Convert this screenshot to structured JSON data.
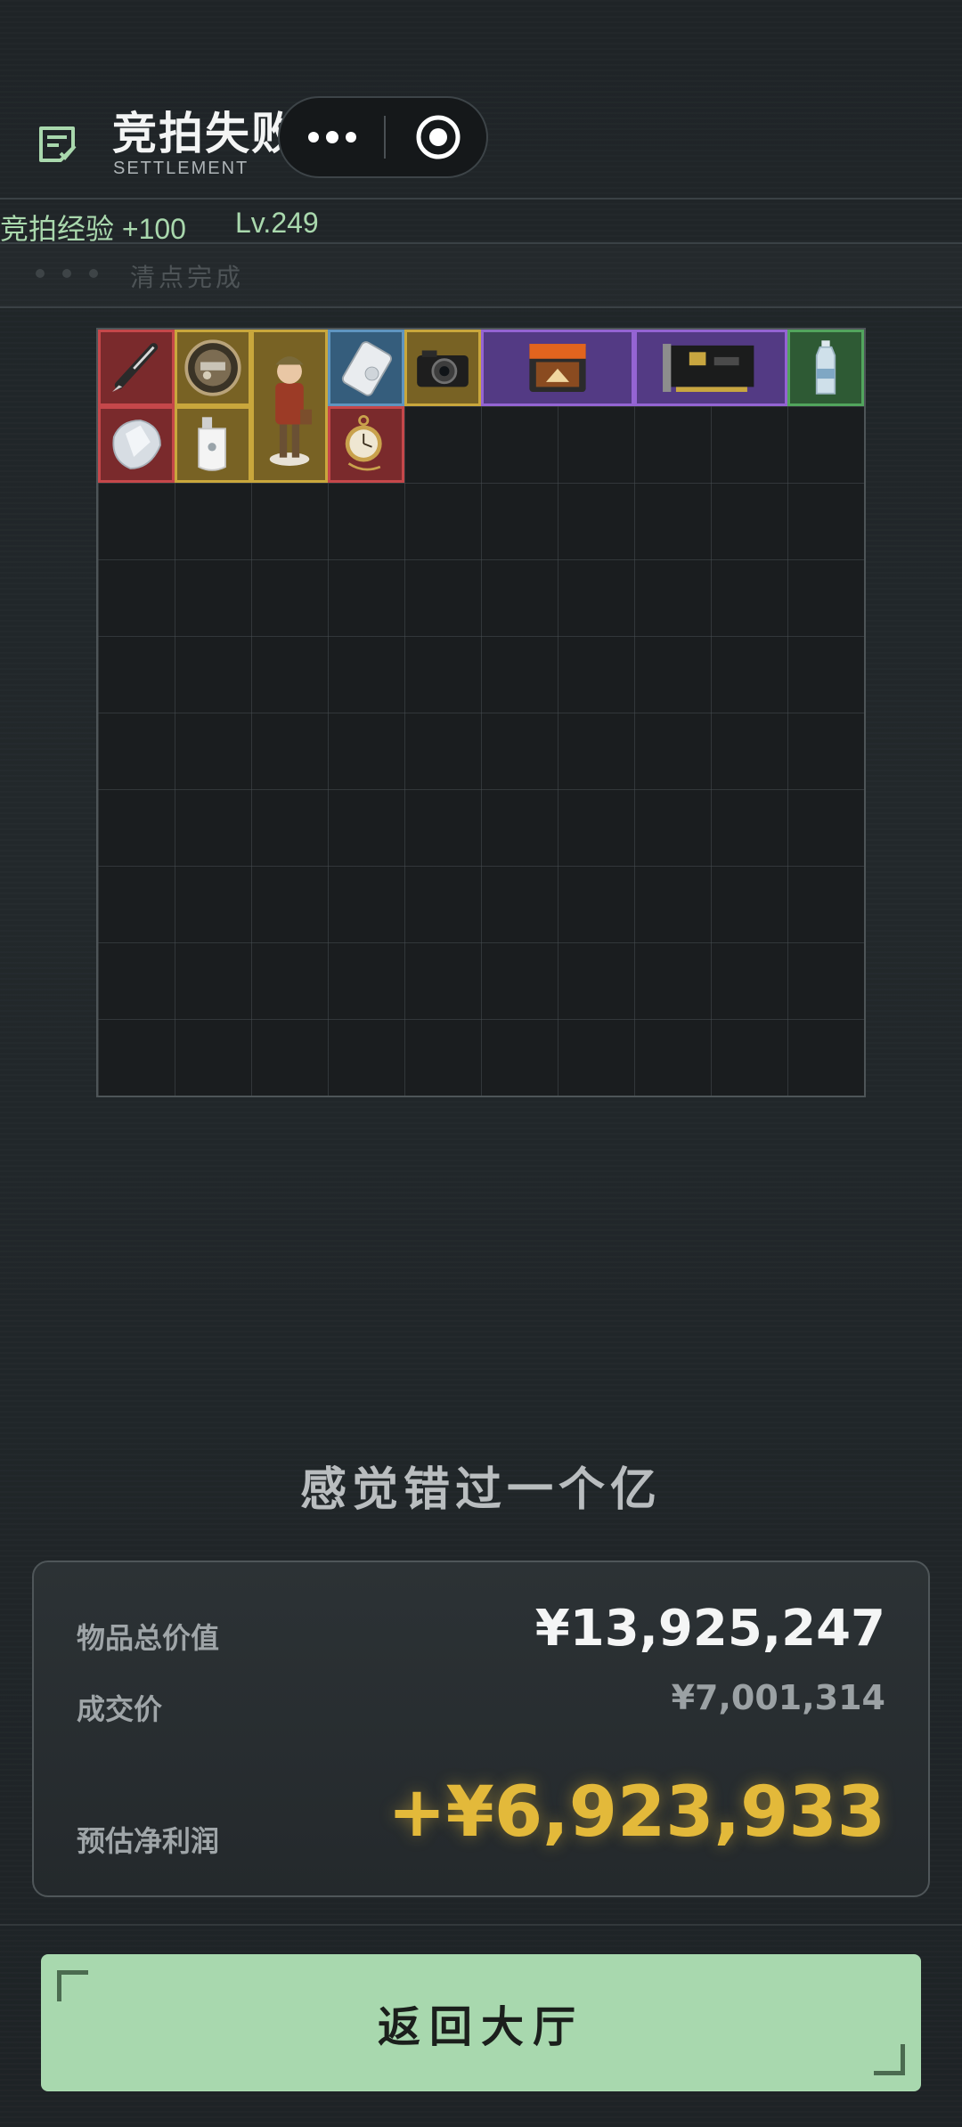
{
  "header": {
    "title": "竞拍失败",
    "subtitle": "SETTLEMENT",
    "icon": "settlement-doc-icon"
  },
  "capsule": {
    "more_icon": "more-dots-icon",
    "target_icon": "target-circle-icon"
  },
  "exp": {
    "label": "竞拍经验 +100",
    "level": "Lv.249"
  },
  "status": {
    "text": "清点完成"
  },
  "items": [
    {
      "name": "item-pen",
      "rarity": "red",
      "icon": "pen-icon"
    },
    {
      "name": "item-music-box",
      "rarity": "gold",
      "icon": "music-box-icon"
    },
    {
      "name": "item-figurine",
      "rarity": "gold",
      "icon": "figurine-icon"
    },
    {
      "name": "item-mp3-player",
      "rarity": "blue",
      "icon": "mp3-player-icon"
    },
    {
      "name": "item-camera",
      "rarity": "gold",
      "icon": "camera-icon"
    },
    {
      "name": "item-game-console-box",
      "rarity": "purple",
      "icon": "console-box-icon"
    },
    {
      "name": "item-sound-card",
      "rarity": "purple",
      "icon": "circuit-board-icon"
    },
    {
      "name": "item-water-bottle",
      "rarity": "green",
      "icon": "bottle-icon"
    },
    {
      "name": "item-diamond",
      "rarity": "red",
      "icon": "diamond-icon"
    },
    {
      "name": "item-usb-drive",
      "rarity": "gold",
      "icon": "usb-drive-icon"
    },
    {
      "name": "item-pocket-watch",
      "rarity": "red",
      "icon": "pocket-watch-icon"
    }
  ],
  "result": {
    "feeling": "感觉错过一个亿",
    "total_label": "物品总价值",
    "total_value": "¥13,925,247",
    "deal_label": "成交价",
    "deal_value": "¥7,001,314",
    "profit_label": "预估净利润",
    "profit_value": "+¥6,923,933"
  },
  "button": {
    "return_label": "返回大厅"
  },
  "colors": {
    "accent_green": "#a8d8ae",
    "profit_gold": "#e3b93a",
    "rarity_red": "#c5474a",
    "rarity_gold": "#c9a73c",
    "rarity_blue": "#5f95c0",
    "rarity_purple": "#9464d3",
    "rarity_green": "#52a55d"
  }
}
